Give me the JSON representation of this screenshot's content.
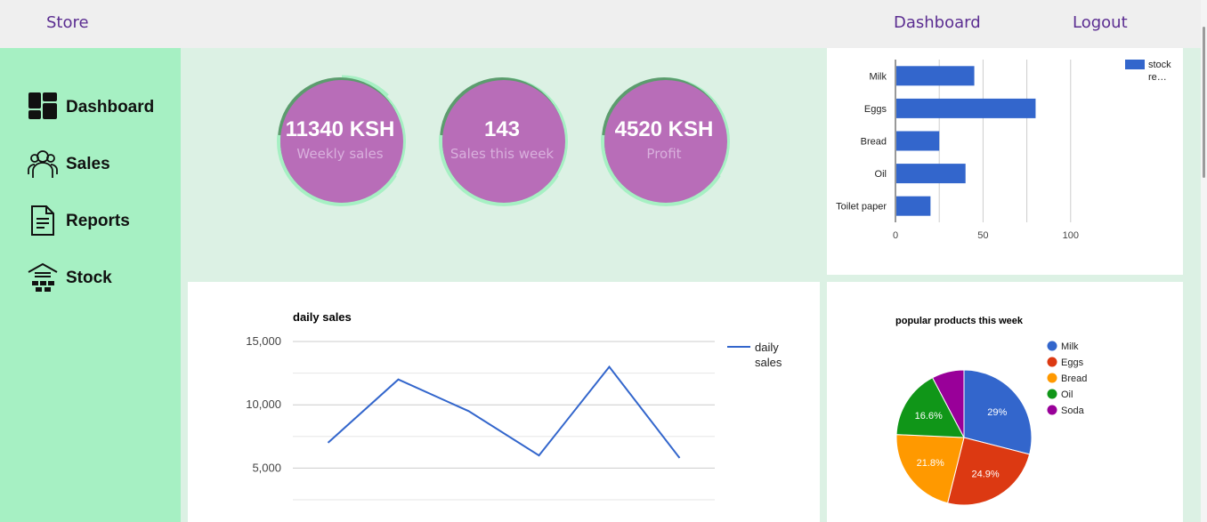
{
  "topbar": {
    "brand": "Store",
    "links": {
      "dashboard": "Dashboard",
      "logout": "Logout"
    }
  },
  "sidebar": {
    "items": [
      {
        "label": "Dashboard",
        "icon": "dashboard-icon"
      },
      {
        "label": "Sales",
        "icon": "users-icon"
      },
      {
        "label": "Reports",
        "icon": "document-icon"
      },
      {
        "label": "Stock",
        "icon": "warehouse-icon"
      }
    ]
  },
  "stats": [
    {
      "value": "11340 KSH",
      "caption": "Weekly sales"
    },
    {
      "value": "143",
      "caption": "Sales this week"
    },
    {
      "value": "4520 KSH",
      "caption": "Profit"
    }
  ],
  "colors": {
    "accent": "#5b2d91",
    "sidebar": "#a6f0c3",
    "content_bg": "#dcf1e4",
    "stat_fill": "#b86db8",
    "stat_ring": "#5c9c6e",
    "bar_blue": "#3366cc",
    "pie": [
      "#3366cc",
      "#dc3912",
      "#ff9900",
      "#109618",
      "#990099"
    ]
  },
  "chart_data": [
    {
      "type": "bar",
      "orientation": "horizontal",
      "categories": [
        "Milk",
        "Eggs",
        "Bread",
        "Oil",
        "Toilet paper"
      ],
      "series": [
        {
          "name": "stock re…",
          "values": [
            45,
            80,
            25,
            40,
            20
          ]
        }
      ],
      "xlim": [
        0,
        125
      ],
      "xticks": [
        "0",
        "50",
        "100"
      ],
      "grid": true,
      "legend": "top-right"
    },
    {
      "type": "line",
      "title": "daily sales",
      "series": [
        {
          "name": "daily sales",
          "values": [
            7000,
            12000,
            9500,
            6000,
            13000,
            5800
          ]
        }
      ],
      "yticks": [
        "15,000",
        "10,000",
        "5,000"
      ],
      "ylim": [
        2500,
        15000
      ],
      "grid": true,
      "legend": "right"
    },
    {
      "type": "pie",
      "title": "popular products this week",
      "slices": [
        {
          "label": "Milk",
          "value": 29,
          "text": "29%"
        },
        {
          "label": "Eggs",
          "value": 24.9,
          "text": "24.9%"
        },
        {
          "label": "Bread",
          "value": 21.8,
          "text": "21.8%"
        },
        {
          "label": "Oil",
          "value": 16.6,
          "text": "16.6%"
        },
        {
          "label": "Soda",
          "value": 7.7,
          "text": ""
        }
      ],
      "legend": "right"
    }
  ]
}
